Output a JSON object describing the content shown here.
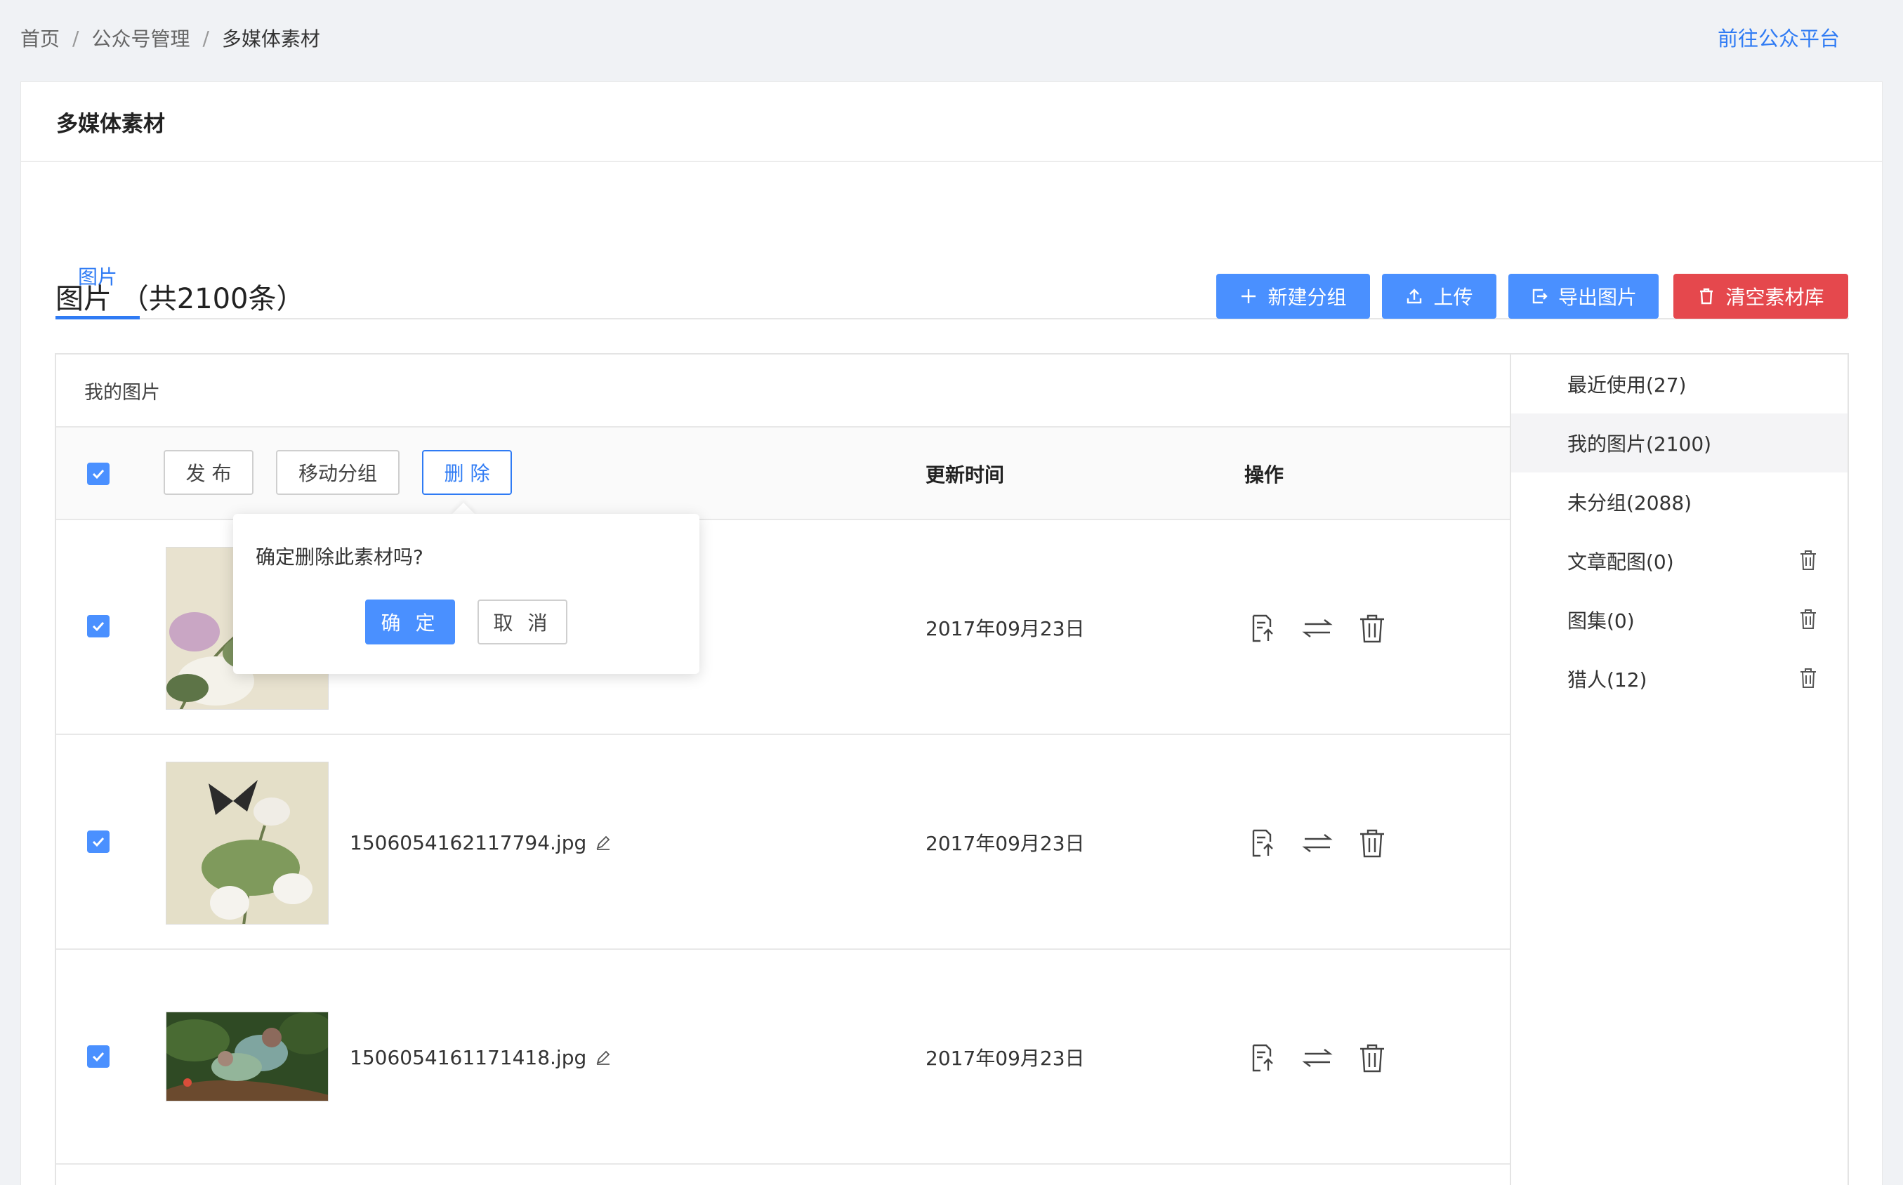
{
  "breadcrumb": {
    "home": "首页",
    "sep": "/",
    "level2": "公众号管理",
    "current": "多媒体素材"
  },
  "top_link": "前往公众平台",
  "card_title": "多媒体素材",
  "tabs": [
    {
      "label": "图片"
    }
  ],
  "section": {
    "title": "图片 （共2100条）"
  },
  "toolbar": {
    "new_group": "新建分组",
    "upload": "上传",
    "export": "导出图片",
    "clear": "清空素材库"
  },
  "table": {
    "group_title": "我的图片",
    "bulk_actions": {
      "publish": "发 布",
      "move": "移动分组",
      "delete": "删 除"
    },
    "columns": {
      "updated": "更新时间",
      "actions": "操作"
    },
    "rows": [
      {
        "filename": "",
        "date": "2017年09月23日",
        "checked": true
      },
      {
        "filename": "1506054162117794.jpg",
        "date": "2017年09月23日",
        "checked": true
      },
      {
        "filename": "1506054161171418.jpg",
        "date": "2017年09月23日",
        "checked": true
      }
    ]
  },
  "popover": {
    "message": "确定删除此素材吗?",
    "confirm": "确 定",
    "cancel": "取 消"
  },
  "groups": [
    {
      "label": "最近使用(27)",
      "deletable": false,
      "selected": false
    },
    {
      "label": "我的图片(2100)",
      "deletable": false,
      "selected": true
    },
    {
      "label": "未分组(2088)",
      "deletable": false,
      "selected": false
    },
    {
      "label": "文章配图(0)",
      "deletable": true,
      "selected": false
    },
    {
      "label": "图集(0)",
      "deletable": true,
      "selected": false
    },
    {
      "label": "猎人(12)",
      "deletable": true,
      "selected": false
    }
  ],
  "colors": {
    "primary": "#4a90ff",
    "link": "#2f7bf4",
    "danger": "#e5484d"
  },
  "icons": {
    "new_group": "plus-icon",
    "upload": "upload-icon",
    "export": "export-icon",
    "clear": "trash-icon",
    "edit": "pencil-icon",
    "publish": "publish-icon",
    "move": "swap-icon",
    "delete": "trash-icon"
  }
}
